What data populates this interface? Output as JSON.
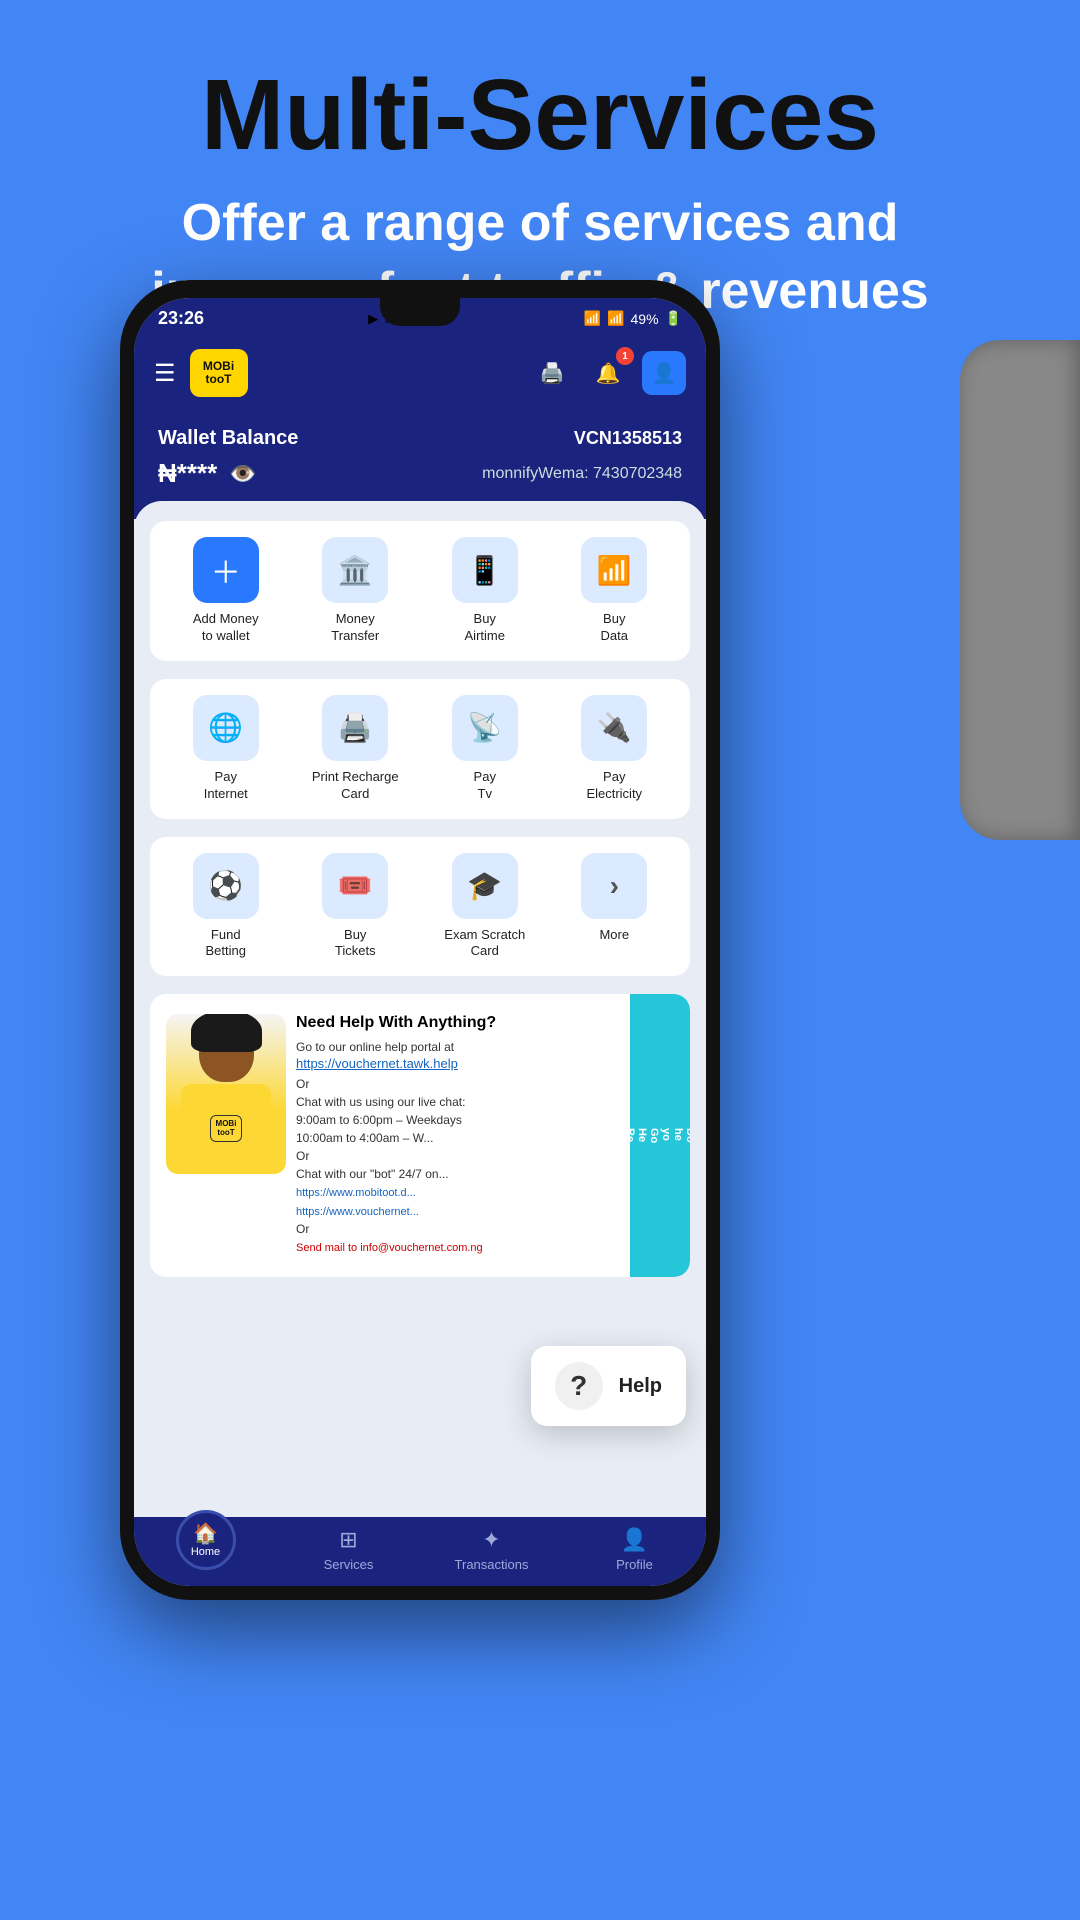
{
  "page": {
    "background_color": "#4285f4",
    "header": {
      "title": "Multi-Services",
      "subtitle": "Offer a range of services and increase foot traffic & revenues"
    }
  },
  "status_bar": {
    "time": "23:26",
    "battery": "49%",
    "icons": [
      "youtube",
      "yt-music",
      "facebook",
      "more"
    ]
  },
  "app_header": {
    "logo_line1": "MOBi",
    "logo_line2": "tooT",
    "notification_count": "1"
  },
  "wallet": {
    "label": "Wallet Balance",
    "vcn": "VCN1358513",
    "amount_masked": "₦****",
    "account_label": "monnifyWema: 7430702348"
  },
  "service_rows": [
    {
      "items": [
        {
          "label": "Add Money\nto wallet",
          "icon": "➕",
          "accent": true
        },
        {
          "label": "Money\nTransfer",
          "icon": "🏛️",
          "accent": false
        },
        {
          "label": "Buy\nAirtime",
          "icon": "📱",
          "accent": false
        },
        {
          "label": "Buy\nData",
          "icon": "📶",
          "accent": false
        }
      ]
    },
    {
      "items": [
        {
          "label": "Pay\nInternet",
          "icon": "🌐",
          "accent": false
        },
        {
          "label": "Print Recharge\nCard",
          "icon": "🖨️",
          "accent": false
        },
        {
          "label": "Pay\nTv",
          "icon": "📡",
          "accent": false
        },
        {
          "label": "Pay\nElectricity",
          "icon": "🔌",
          "accent": false
        }
      ]
    },
    {
      "items": [
        {
          "label": "Fund\nBetting",
          "icon": "⚽",
          "accent": false
        },
        {
          "label": "Buy\nTickets",
          "icon": "🎟️",
          "accent": false
        },
        {
          "label": "Exam Scratch\nCard",
          "icon": "🎓",
          "accent": false
        },
        {
          "label": "More",
          "icon": "›",
          "accent": false
        }
      ]
    }
  ],
  "help_section": {
    "title": "Need Help With Anything?",
    "body_line1": "Go to our online help portal at",
    "link": "https://vouchernet.tawk.help",
    "body_line2": "Or",
    "chat_info": "Chat with us using our live chat:\n9:00am to 6:00pm – Weekdays\n10:00am to 4:00am – W...",
    "body_line3": "Or",
    "bot_info": "Chat with our \"bot\" 24/7 on...",
    "teal_text": "Do\nhelp\nyou\n\nGo\nHe\nRe"
  },
  "help_popup": {
    "icon": "?",
    "label": "Help"
  },
  "bottom_nav": {
    "items": [
      {
        "label": "Home",
        "icon": "🏠",
        "active": true
      },
      {
        "label": "Services",
        "icon": "⊞",
        "active": false
      },
      {
        "label": "Transactions",
        "icon": "✦",
        "active": false
      },
      {
        "label": "Profile",
        "icon": "👤",
        "active": false
      }
    ]
  }
}
